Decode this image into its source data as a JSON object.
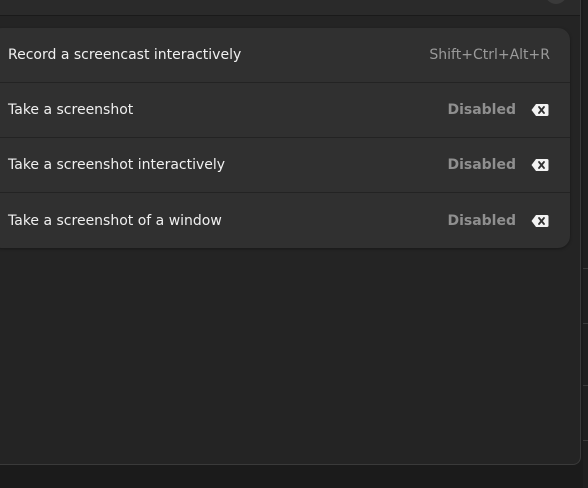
{
  "shortcuts": {
    "rows": [
      {
        "title": "Record a screencast interactively",
        "accelerator": "Shift+Ctrl+Alt+R"
      },
      {
        "title": "Take a screenshot",
        "status": "Disabled",
        "clear_icon": "backspace-x-icon"
      },
      {
        "title": "Take a screenshot interactively",
        "status": "Disabled",
        "clear_icon": "backspace-x-icon"
      },
      {
        "title": "Take a screenshot of a window",
        "status": "Disabled",
        "clear_icon": "backspace-x-icon"
      }
    ]
  },
  "colors": {
    "window_bg": "#242424",
    "list_bg": "#303030",
    "text": "#f0f0f0",
    "muted_text": "#9a9a9a"
  }
}
